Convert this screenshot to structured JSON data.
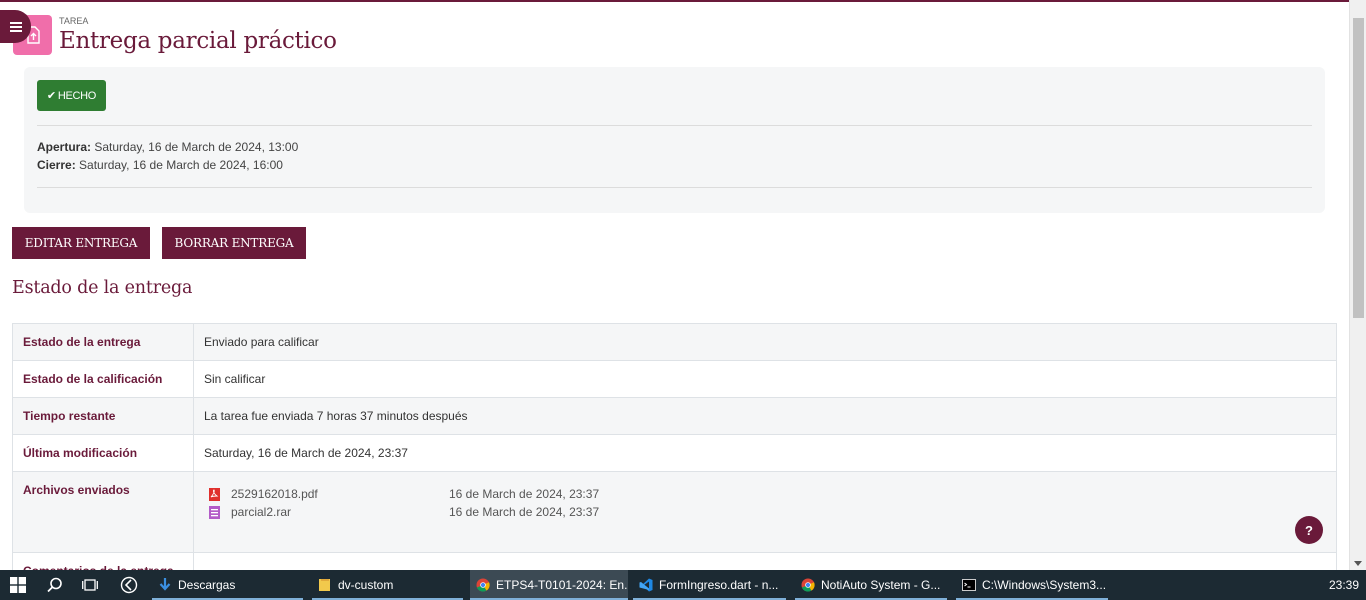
{
  "header": {
    "pretitle": "TAREA",
    "title": "Entrega parcial práctico"
  },
  "activity": {
    "done_badge": "HECHO",
    "open_label": "Apertura:",
    "open_value": "Saturday, 16 de March de 2024, 13:00",
    "close_label": "Cierre:",
    "close_value": "Saturday, 16 de March de 2024, 16:00"
  },
  "actions": {
    "edit_label": "EDITAR ENTREGA",
    "delete_label": "BORRAR ENTREGA"
  },
  "status": {
    "section_title": "Estado de la entrega",
    "rows": [
      {
        "label": "Estado de la entrega",
        "value": "Enviado para calificar"
      },
      {
        "label": "Estado de la calificación",
        "value": "Sin calificar"
      },
      {
        "label": "Tiempo restante",
        "value": "La tarea fue enviada 7 horas 37 minutos después"
      },
      {
        "label": "Última modificación",
        "value": "Saturday, 16 de March de 2024, 23:37"
      },
      {
        "label": "Archivos enviados",
        "value": ""
      },
      {
        "label": "Comentarios de la entrega",
        "value": ""
      }
    ],
    "files": [
      {
        "name": "2529162018.pdf",
        "date": "16 de March de 2024, 23:37",
        "icon": "pdf-icon"
      },
      {
        "name": "parcial2.rar",
        "date": "16 de March de 2024, 23:37",
        "icon": "archive-icon"
      }
    ]
  },
  "help": {
    "label": "?"
  },
  "taskbar": {
    "tasks": [
      {
        "label": "Descargas",
        "icon": "download-arrow-icon"
      },
      {
        "label": "dv-custom",
        "icon": "folder-icon"
      },
      {
        "label": "ETPS4-T0101-2024: En...",
        "icon": "chrome-icon"
      },
      {
        "label": "FormIngreso.dart - n...",
        "icon": "vscode-icon"
      },
      {
        "label": "NotiAuto System - G...",
        "icon": "chrome-icon"
      },
      {
        "label": "C:\\Windows\\System3...",
        "icon": "cmd-icon"
      }
    ],
    "clock": "23:39"
  },
  "colors": {
    "brand": "#6a1a3a",
    "done": "#2f7d32",
    "activity_icon": "#f06eaa",
    "taskbar": "#1c2a33"
  }
}
